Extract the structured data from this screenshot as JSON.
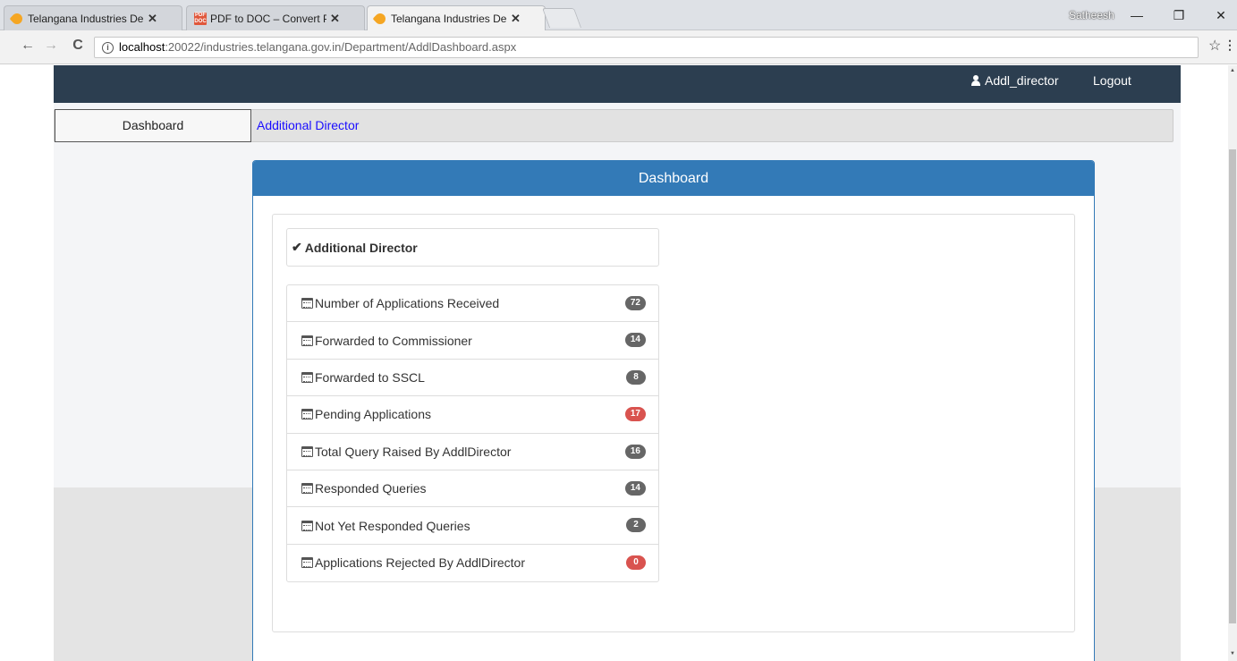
{
  "browser": {
    "tabs": [
      {
        "title": "Telangana Industries Dep",
        "favicon": "flame-icon",
        "active": false
      },
      {
        "title": "PDF to DOC – Convert PD",
        "favicon": "pdf-icon",
        "active": false
      },
      {
        "title": "Telangana Industries Dep",
        "favicon": "flame-icon",
        "active": true
      }
    ],
    "os_user": "Satheesh",
    "url_host": "localhost",
    "url_rest": ":20022/industries.telangana.gov.in/Department/AddlDashboard.aspx"
  },
  "header": {
    "user_name": "Addl_director",
    "logout_label": "Logout"
  },
  "menu": {
    "dashboard_label": "Dashboard",
    "additional_director_label": "Additional Director"
  },
  "panel": {
    "title": "Dashboard",
    "list_header": "Additional Director",
    "items": [
      {
        "label": "Number of Applications Received",
        "count": "72",
        "badge_color": "#666666"
      },
      {
        "label": "Forwarded to Commissioner",
        "count": "14",
        "badge_color": "#666666"
      },
      {
        "label": "Forwarded to SSCL",
        "count": "8",
        "badge_color": "#666666"
      },
      {
        "label": "Pending Applications",
        "count": "17",
        "badge_color": "#d9534f"
      },
      {
        "label": "Total Query Raised By AddlDirector",
        "count": "16",
        "badge_color": "#666666"
      },
      {
        "label": "Responded Queries",
        "count": "14",
        "badge_color": "#666666"
      },
      {
        "label": "Not Yet Responded Queries",
        "count": "2",
        "badge_color": "#666666"
      },
      {
        "label": "Applications Rejected By AddlDirector",
        "count": "0",
        "badge_color": "#d9534f"
      }
    ]
  },
  "colors": {
    "topbar": "#2c3e50",
    "panel_primary": "#337ab7",
    "link": "#1a0dff"
  }
}
